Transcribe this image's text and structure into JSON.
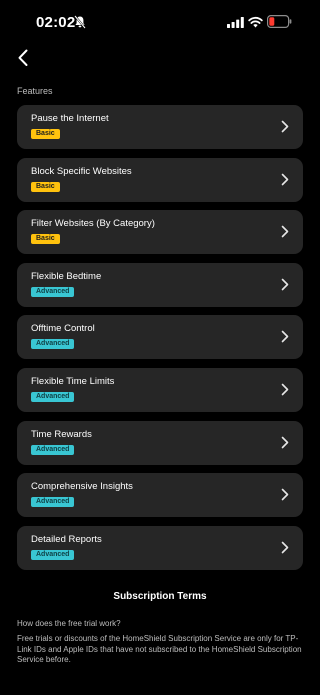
{
  "status_bar": {
    "time": "02:02"
  },
  "features_label": "Features",
  "features": [
    {
      "name": "Pause the Internet",
      "tier": "Basic"
    },
    {
      "name": "Block Specific Websites",
      "tier": "Basic"
    },
    {
      "name": "Filter Websites (By Category)",
      "tier": "Basic"
    },
    {
      "name": "Flexible Bedtime",
      "tier": "Advanced"
    },
    {
      "name": "Offtime Control",
      "tier": "Advanced"
    },
    {
      "name": "Flexible Time Limits",
      "tier": "Advanced"
    },
    {
      "name": "Time Rewards",
      "tier": "Advanced"
    },
    {
      "name": "Comprehensive Insights",
      "tier": "Advanced"
    },
    {
      "name": "Detailed Reports",
      "tier": "Advanced"
    }
  ],
  "subscription_terms": "Subscription Terms",
  "faq": {
    "question": "How does the free trial work?",
    "answer": "Free trials or discounts of the HomeShield Subscription Service are only for TP-Link IDs and Apple IDs that have not subscribed to the HomeShield Subscription Service before."
  },
  "colors": {
    "basic_badge": "#ffc20e",
    "advanced_badge": "#39c6d3",
    "card": "#262626",
    "background": "#000000"
  }
}
